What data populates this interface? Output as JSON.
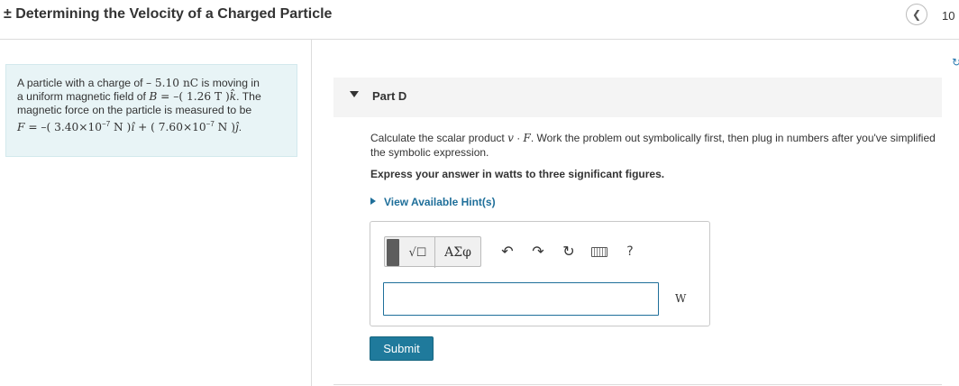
{
  "header": {
    "title": "± Determining the Velocity of a Charged Particle",
    "page_number": "10"
  },
  "problem": {
    "line1_a": "A particle with a charge of ",
    "line1_b": "– 5.10 ",
    "line1_c": "nC",
    "line1_d": " is moving in",
    "line2_a": "a uniform magnetic field of ",
    "line2_b": "B",
    "line2_c": " = –( 1.26 ",
    "line2_d": "T",
    "line2_e": " )",
    "line2_f": "k̂",
    "line2_g": ". The",
    "line3": "magnetic force on the particle is measured to be",
    "line4_a": "F",
    "line4_b": " = –( 3.40×10",
    "line4_exp1": "−7",
    "line4_c": " N )",
    "line4_d": "î",
    "line4_e": " + ( 7.60×10",
    "line4_exp2": "−7",
    "line4_f": " N )",
    "line4_g": "ĵ",
    "line4_h": "."
  },
  "part": {
    "label": "Part D",
    "question_a": "Calculate the scalar product ",
    "question_v": "v",
    "question_dot": " · ",
    "question_F": "F",
    "question_b": ". Work the problem out symbolically first, then plug in numbers after you've simplified the symbolic expression.",
    "instruction": "Express your answer in watts to three significant figures.",
    "hint_label": "View Available Hint(s)"
  },
  "answer": {
    "template_label": "√☐",
    "greek_label": "ΑΣφ",
    "help_label": "?",
    "input_value": "",
    "unit": "W",
    "submit_label": "Submit"
  },
  "icons": {
    "nav": "chevron-left-icon",
    "undo": "undo-icon",
    "redo": "redo-icon",
    "reset": "reset-icon",
    "keyboard": "keyboard-icon",
    "help": "help-icon"
  },
  "colors": {
    "accent": "#1f7a9c",
    "link": "#1f6f9a",
    "problem_bg": "#e8f4f6"
  }
}
